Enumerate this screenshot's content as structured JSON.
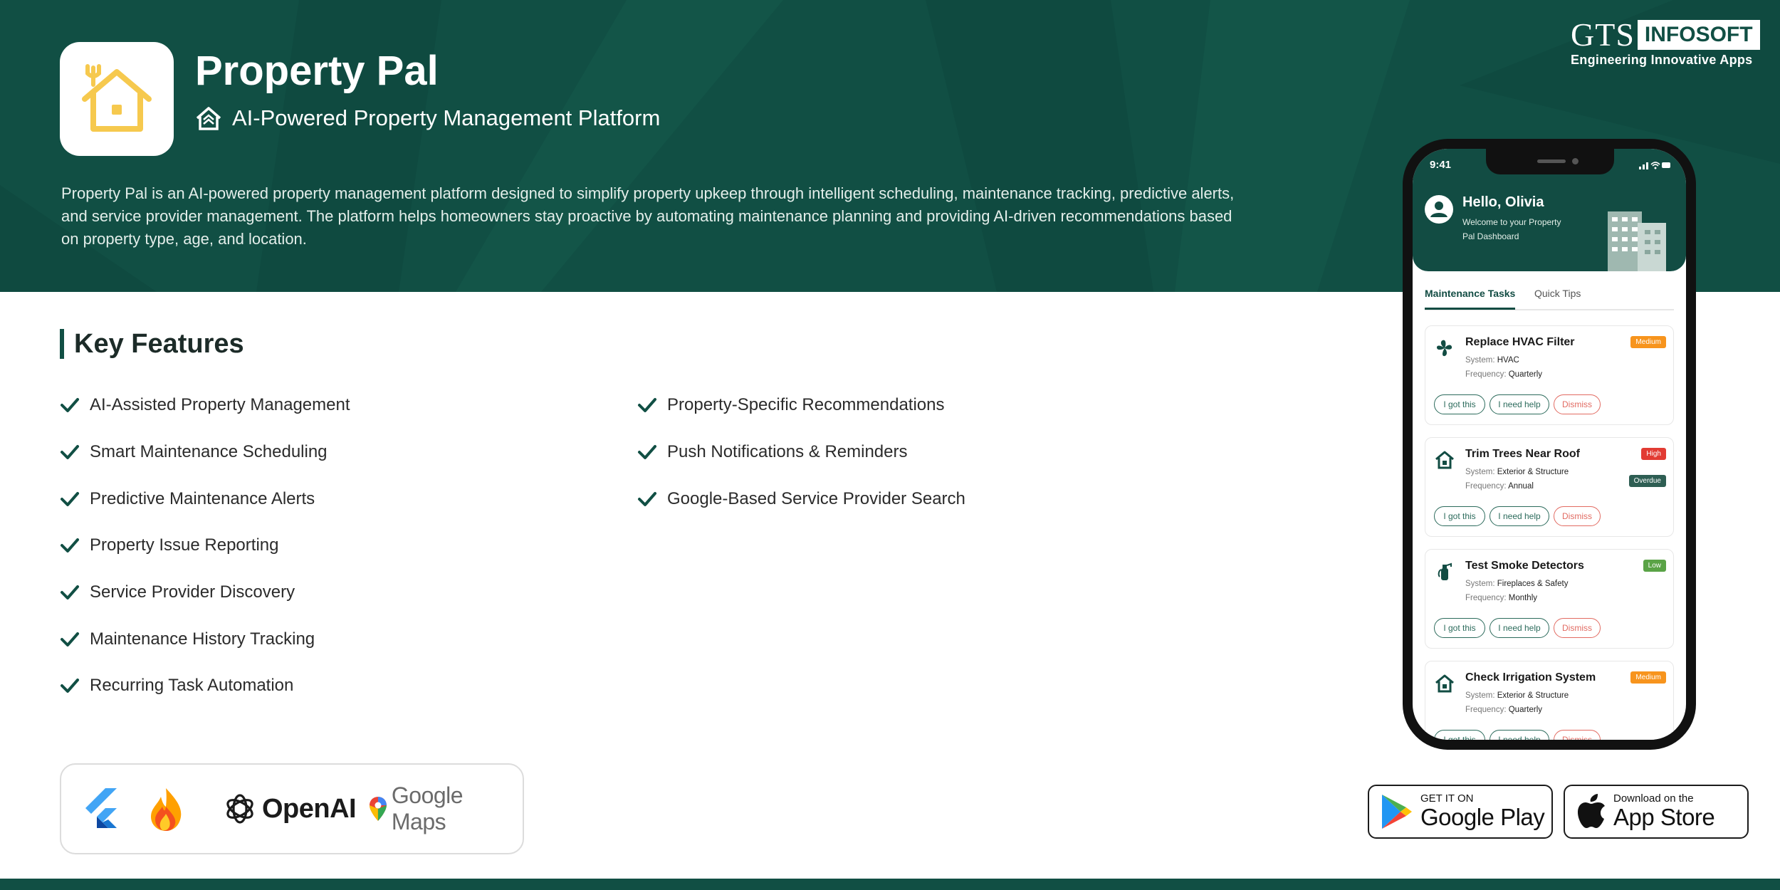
{
  "hero": {
    "title": "Property Pal",
    "subtitle": "AI-Powered Property Management Platform",
    "description": "Property Pal is an AI-powered property management platform designed to simplify property upkeep through intelligent scheduling, maintenance tracking, predictive alerts, and service provider management. The platform helps homeowners stay proactive by automating maintenance planning and providing AI-driven recommendations based on property type, age, and location."
  },
  "brand": {
    "logo_mark": "GTS",
    "logo_box": "INFOSOFT",
    "tagline": "Engineering Innovative Apps"
  },
  "features": {
    "heading": "Key Features",
    "col1": [
      "AI-Assisted Property Management",
      "Smart Maintenance Scheduling",
      "Predictive Maintenance Alerts",
      "Property Issue Reporting",
      "Service Provider Discovery",
      "Maintenance History Tracking",
      "Recurring Task Automation"
    ],
    "col2": [
      "Property-Specific Recommendations",
      "Push Notifications & Reminders",
      "Google-Based Service Provider Search"
    ]
  },
  "tech": {
    "items": [
      "flutter-icon",
      "firebase-icon",
      "openai-icon",
      "google-maps-icon"
    ],
    "openai_label": "OpenAI",
    "gmaps_label": "Google Maps"
  },
  "stores": {
    "google": {
      "small": "GET IT ON",
      "big": "Google Play"
    },
    "apple": {
      "small": "Download on the",
      "big": "App Store"
    }
  },
  "phone": {
    "time": "9:41",
    "greeting": "Hello, Olivia",
    "welcome": "Welcome to your Property Pal Dashboard",
    "tabs": [
      "Maintenance Tasks",
      "Quick Tips"
    ],
    "system_prefix": "System:",
    "frequency_prefix": "Frequency:",
    "actions": [
      "I got this",
      "I need help",
      "Dismiss"
    ],
    "tasks": [
      {
        "title": "Replace HVAC Filter",
        "system": "HVAC",
        "frequency": "Quarterly",
        "priority": "Medium",
        "icon": "fan-icon"
      },
      {
        "title": "Trim Trees Near Roof",
        "system": "Exterior & Structure",
        "frequency": "Annual",
        "priority": "High",
        "status": "Overdue",
        "icon": "house-icon"
      },
      {
        "title": "Test Smoke Detectors",
        "system": "Fireplaces & Safety",
        "frequency": "Monthly",
        "priority": "Low",
        "icon": "extinguisher-icon"
      },
      {
        "title": "Check Irrigation System",
        "system": "Exterior & Structure",
        "frequency": "Quarterly",
        "priority": "Medium",
        "icon": "house-icon"
      }
    ]
  },
  "colors": {
    "brand_green": "#114f44",
    "accent_yellow": "#f6c94e",
    "medium": "#f7941d",
    "high": "#e23b33",
    "low": "#5aa346",
    "overdue": "#2e5e53"
  }
}
